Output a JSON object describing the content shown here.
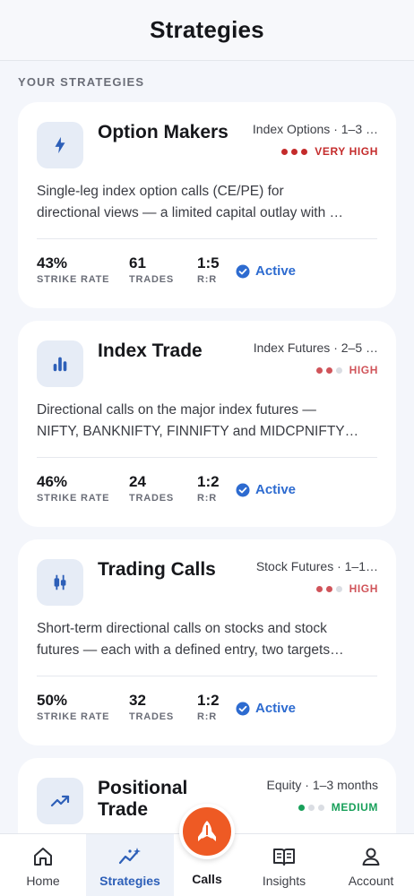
{
  "header": {
    "title": "Strategies"
  },
  "section_label": "YOUR STRATEGIES",
  "colors": {
    "accent": "#2d6bd0",
    "risk_very_high": "#c42b2b",
    "risk_high": "#d0545a",
    "risk_medium": "#18a05a",
    "fab": "#ee5a24"
  },
  "strategies": [
    {
      "title": "Option Makers",
      "meta": "Index Options · 1–3 …",
      "icon": "lightning-icon",
      "risk_label": "VERY HIGH",
      "risk_level": 3,
      "desc_line1": "Single-leg index option calls (CE/PE) for",
      "desc_line2": "directional views — a limited capital outlay with …",
      "strike_rate": "43%",
      "strike_rate_label": "STRIKE RATE",
      "trades": "61",
      "trades_label": "TRADES",
      "rr": "1:5",
      "rr_label": "R:R",
      "status": "Active"
    },
    {
      "title": "Index Trade",
      "meta": "Index Futures · 2–5 …",
      "icon": "bar-chart-icon",
      "risk_label": "HIGH",
      "risk_level": 2,
      "desc_line1": "Directional calls on the major index futures —",
      "desc_line2": "NIFTY, BANKNIFTY, FINNIFTY and MIDCPNIFTY…",
      "strike_rate": "46%",
      "strike_rate_label": "STRIKE RATE",
      "trades": "24",
      "trades_label": "TRADES",
      "rr": "1:2",
      "rr_label": "R:R",
      "status": "Active"
    },
    {
      "title": "Trading Calls",
      "meta": "Stock Futures · 1–1…",
      "icon": "candlestick-icon",
      "risk_label": "HIGH",
      "risk_level": 2,
      "desc_line1": "Short-term directional calls on stocks and stock",
      "desc_line2": "futures — each with a defined entry, two targets…",
      "strike_rate": "50%",
      "strike_rate_label": "STRIKE RATE",
      "trades": "32",
      "trades_label": "TRADES",
      "rr": "1:2",
      "rr_label": "R:R",
      "status": "Active"
    },
    {
      "title": "Positional Trade",
      "meta": "Equity · 1–3 months",
      "icon": "trend-up-icon",
      "risk_label": "MEDIUM",
      "risk_level": 1
    }
  ],
  "nav": {
    "items": [
      {
        "label": "Home",
        "icon": "home-icon"
      },
      {
        "label": "Strategies",
        "icon": "strategies-icon",
        "active": true
      },
      {
        "label": "Calls",
        "icon": "rocket-icon"
      },
      {
        "label": "Insights",
        "icon": "book-icon"
      },
      {
        "label": "Account",
        "icon": "user-icon"
      }
    ]
  }
}
